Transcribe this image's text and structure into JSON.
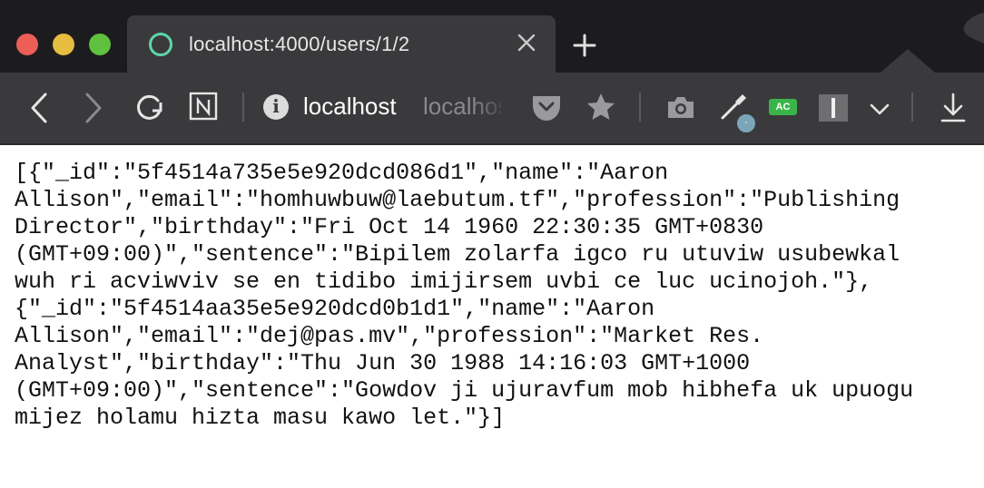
{
  "browser": {
    "tab": {
      "title": "localhost:4000/users/1/2",
      "favicon": "circle-icon",
      "close_icon": "close-icon"
    },
    "new_tab_icon": "plus-icon",
    "toolbar": {
      "icons": [
        "back-icon",
        "forward-icon",
        "reload-icon",
        "notion-icon",
        "info-icon",
        "pocket-icon",
        "star-icon",
        "camera-icon",
        "eyedropper-icon",
        "ac-badge",
        "reader-icon",
        "chevron-down-icon",
        "download-icon"
      ],
      "address_host": "localhost",
      "address_ghost": "localhost",
      "ac_badge": "AC",
      "extension_badge_text": "·"
    }
  },
  "page": {
    "json_lines": [
      "[{\"_id\":\"5f4514a735e5e920dcd086d1\",\"name\":\"Aaron",
      "Allison\",\"email\":\"homhuwbuw@laebutum.tf\",\"profession\":\"Publishing",
      "Director\",\"birthday\":\"Fri Oct 14 1960 22:30:35 GMT+0830",
      "(GMT+09:00)\",\"sentence\":\"Bipilem zolarfa igco ru utuviw usubewkal",
      "wuh ri acviwviv se en tidibo imijirsem uvbi ce luc ucinojoh.\"},",
      "{\"_id\":\"5f4514aa35e5e920dcd0b1d1\",\"name\":\"Aaron",
      "Allison\",\"email\":\"dej@pas.mv\",\"profession\":\"Market Res.",
      "Analyst\",\"birthday\":\"Thu Jun 30 1988 14:16:03 GMT+1000",
      "(GMT+09:00)\",\"sentence\":\"Gowdov ji ujuravfum mob hibhefa uk upuogu",
      "mijez holamu hizta masu kawo let.\"}]"
    ]
  },
  "colors": {
    "tabstrip": "#1c1c1e",
    "toolbar": "#3a3a3c",
    "favicon": "#5ed6a8",
    "ac_badge": "#3ab44a",
    "traffic_red": "#ec5f57",
    "traffic_yellow": "#e6bd41",
    "traffic_green": "#5fc13f"
  }
}
